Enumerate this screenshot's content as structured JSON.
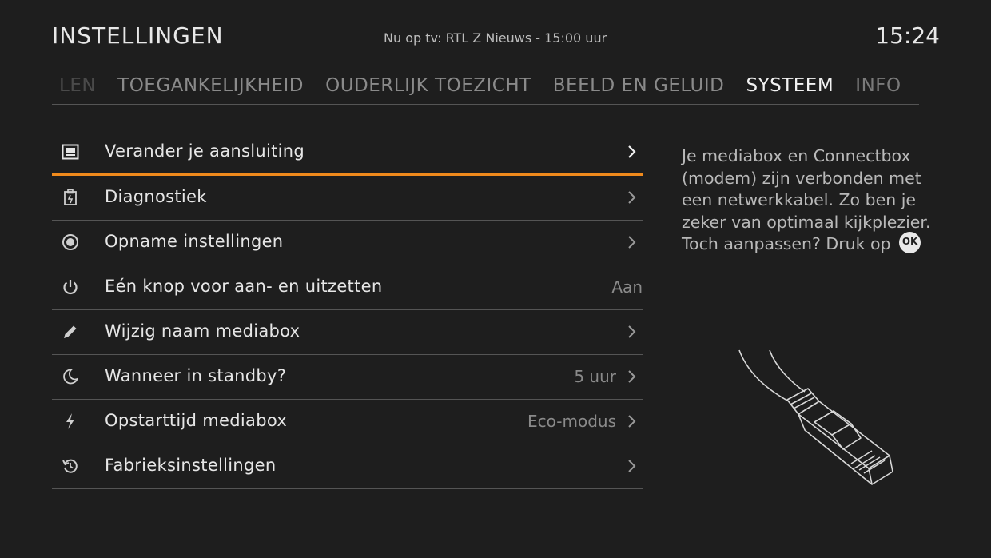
{
  "header": {
    "title": "INSTELLINGEN",
    "now_playing": "Nu op tv: RTL Z Nieuws - 15:00 uur",
    "clock": "15:24"
  },
  "tabs": [
    {
      "label": "LEN",
      "active": false
    },
    {
      "label": "TOEGANKELIJKHEID",
      "active": false
    },
    {
      "label": "OUDERLIJK TOEZICHT",
      "active": false
    },
    {
      "label": "BEELD EN GELUID",
      "active": false
    },
    {
      "label": "SYSTEEM",
      "active": true
    },
    {
      "label": "INFO",
      "active": false
    }
  ],
  "menu": {
    "items": [
      {
        "label": "Verander je aansluiting",
        "value": "",
        "icon": "connection-icon",
        "selected": true
      },
      {
        "label": "Diagnostiek",
        "value": "",
        "icon": "diagnostics-icon"
      },
      {
        "label": "Opname instellingen",
        "value": "",
        "icon": "record-icon"
      },
      {
        "label": "Eén knop voor aan- en uitzetten",
        "value": "Aan",
        "icon": "power-icon"
      },
      {
        "label": "Wijzig naam mediabox",
        "value": "",
        "icon": "pencil-icon"
      },
      {
        "label": "Wanneer in standby?",
        "value": "5 uur",
        "icon": "moon-icon"
      },
      {
        "label": "Opstarttijd mediabox",
        "value": "Eco-modus",
        "icon": "lightning-icon"
      },
      {
        "label": "Fabrieksinstellingen",
        "value": "",
        "icon": "reset-icon"
      }
    ]
  },
  "description": {
    "text": "Je mediabox en Connectbox (modem) zijn verbonden met een netwerkkabel. Zo ben je zeker van optimaal kijkplezier. Toch aanpassen? Druk op",
    "ok_label": "OK"
  },
  "colors": {
    "background": "#1e1e1e",
    "accent": "#f08a1c",
    "divider": "#555555"
  }
}
